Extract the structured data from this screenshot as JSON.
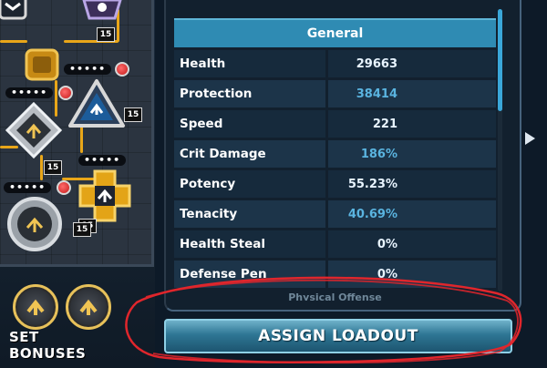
{
  "mod_board": {
    "level_badges": [
      "15",
      "15",
      "15",
      "15",
      "15"
    ],
    "set_bonuses_label": "SET BONUSES"
  },
  "stats": {
    "header": "General",
    "rows": [
      {
        "label": "Health",
        "value": "29663",
        "tone": "white"
      },
      {
        "label": "Protection",
        "value": "38414",
        "tone": "blue"
      },
      {
        "label": "Speed",
        "value": "221",
        "tone": "white"
      },
      {
        "label": "Crit Damage",
        "value": "186%",
        "tone": "blue"
      },
      {
        "label": "Potency",
        "value": "55.23%",
        "tone": "white"
      },
      {
        "label": "Tenacity",
        "value": "40.69%",
        "tone": "blue"
      },
      {
        "label": "Health Steal",
        "value": "0%",
        "tone": "white"
      },
      {
        "label": "Defense Pen",
        "value": "0%",
        "tone": "white"
      }
    ],
    "next_section_peek": "Physical Offense"
  },
  "assign_button": {
    "label": "ASSIGN LOADOUT"
  },
  "icons": {
    "next_arrow": "chevron-right-icon",
    "mod_shapes": [
      "square-mod-icon",
      "triangle-mod-icon",
      "diamond-mod-icon",
      "cross-mod-icon",
      "circle-mod-icon"
    ]
  },
  "colors": {
    "header_blue": "#2f8bb3",
    "row_dark": "#162a3c",
    "button_blue": "#2e7694",
    "wire_gold": "#e9a619",
    "annotation_red": "#e0262c"
  }
}
